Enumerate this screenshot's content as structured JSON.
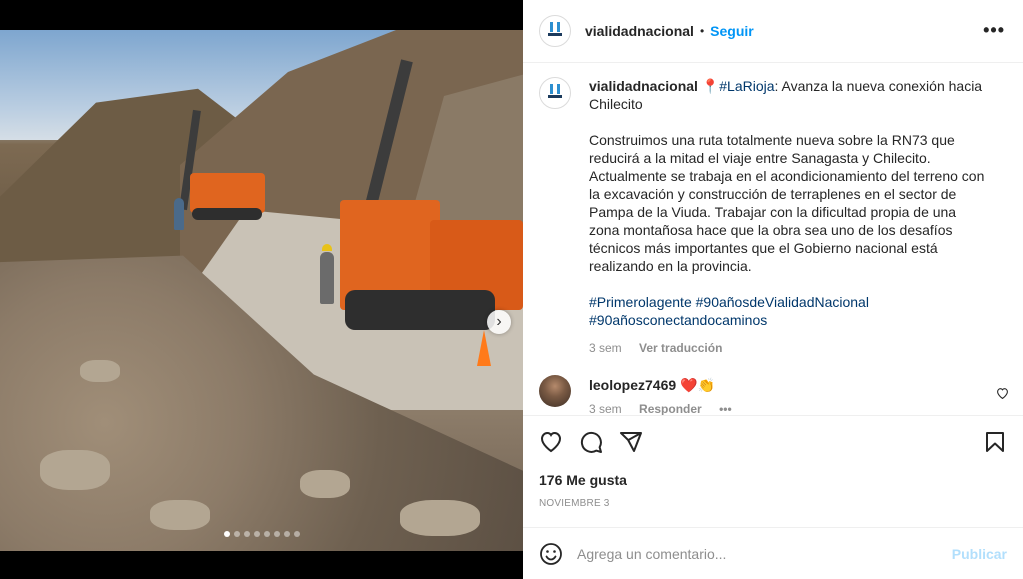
{
  "post": {
    "username": "vialidadnacional",
    "separator": "•",
    "follow_label": "Seguir",
    "more_label": "•••"
  },
  "caption": {
    "username": "vialidadnacional",
    "pin_emoji": "📍",
    "line1_tag": "#LaRioja",
    "line1_rest": ": Avanza la nueva conexión hacia Chilecito",
    "paragraph": "Construimos una ruta totalmente nueva sobre la RN73 que reducirá a la mitad el viaje entre Sanagasta y Chilecito. Actualmente se trabaja en el acondicionamiento del terreno con la excavación y construcción de terraplenes en el sector de Pampa de la Viuda. Trabajar con la dificultad propia de una zona montañosa hace que la obra sea uno de los desafíos técnicos más importantes que el Gobierno nacional está realizando en la provincia.",
    "tag1": "#Primerolagente",
    "tag2": "#90añosdeVialidadNacional",
    "tag3": "#90añosconectandocaminos",
    "time": "3 sem",
    "translate": "Ver traducción"
  },
  "comment": {
    "username": "leolopez7469",
    "text": "❤️👏",
    "time": "3 sem",
    "reply": "Responder",
    "more": "•••"
  },
  "stats": {
    "likes": "176 Me gusta",
    "date": "NOVIEMBRE 3"
  },
  "add_comment": {
    "placeholder": "Agrega un comentario...",
    "publish_label": "Publicar",
    "emoji_icon": "smiley-icon"
  },
  "carousel": {
    "next_label": "›",
    "total": 8,
    "active_index": 0
  },
  "colors": {
    "accent": "#0095f6",
    "hashtag": "#00376b",
    "muted": "#8e8e8e"
  }
}
